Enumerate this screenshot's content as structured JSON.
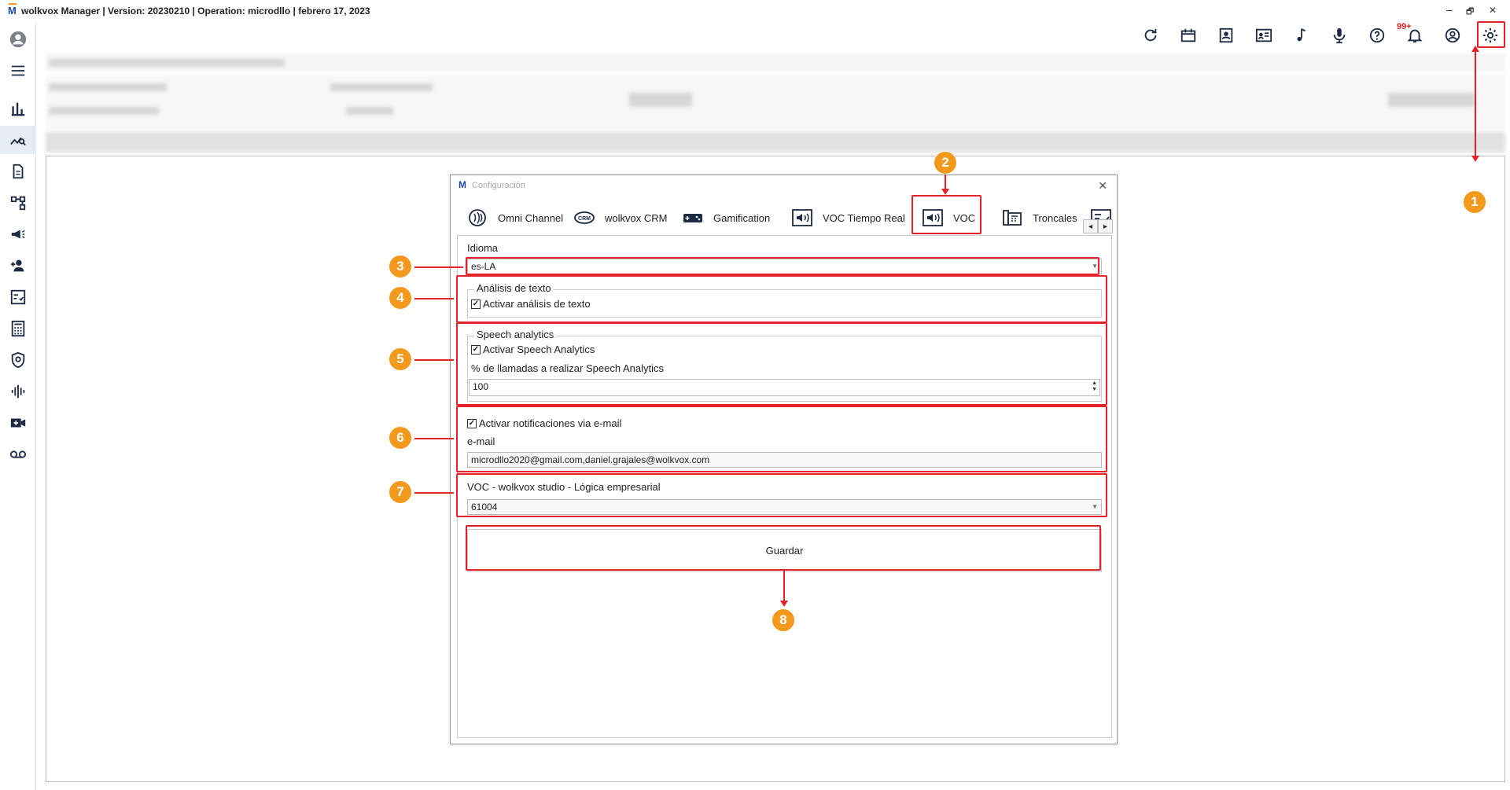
{
  "window": {
    "logo": "M",
    "title": "wolkvox Manager  | Version: 20230210 |  Operation: microdllo | febrero 17, 2023",
    "controls": [
      "–",
      "🗗",
      "✕"
    ]
  },
  "toolbar": {
    "icons": [
      "refresh-icon",
      "ticket-icon",
      "contacts-book-icon",
      "id-card-icon",
      "music-note-icon",
      "microphone-icon",
      "help-icon",
      "bell-icon",
      "user-circle-icon",
      "settings-gear-icon"
    ],
    "notification_badge": "99+"
  },
  "sidebar": {
    "icons": [
      "avatar-icon",
      "menu-icon",
      "bar-chart-icon",
      "analytics-search-icon",
      "document-icon",
      "flow-diagram-icon",
      "megaphone-icon",
      "user-add-icon",
      "checklist-icon",
      "calculator-icon",
      "shield-icon",
      "audio-wave-icon",
      "video-add-icon",
      "voicemail-icon"
    ]
  },
  "dialog": {
    "logo": "M",
    "title": "Configuración",
    "close": "✕",
    "tabs": [
      {
        "label": "Omni Channel",
        "icon": "omni-channel-icon"
      },
      {
        "label": "wolkvox CRM",
        "icon": "crm-icon"
      },
      {
        "label": "Gamification",
        "icon": "gamepad-icon"
      },
      {
        "label": "VOC Tiempo Real",
        "icon": "speaker-realtime-icon"
      },
      {
        "label": "VOC",
        "icon": "speaker-icon"
      },
      {
        "label": "Troncales",
        "icon": "phone-trunk-icon"
      }
    ],
    "tab_scroll": [
      "◂",
      "▸"
    ],
    "idioma": {
      "label": "Idioma",
      "value": "es-LA"
    },
    "text_analysis": {
      "title": "Análisis de texto",
      "checkbox_label": "Activar análisis de texto",
      "checked": true
    },
    "speech": {
      "title": "Speech analytics",
      "checkbox_label": "Activar Speech Analytics",
      "checked": true,
      "percent_label": "% de llamadas a realizar Speech Analytics",
      "percent_value": "100"
    },
    "email": {
      "checkbox_label": "Activar notificaciones via e-mail",
      "checked": true,
      "label": "e-mail",
      "value": "microdllo2020@gmail.com,daniel.grajales@wolkvox.com"
    },
    "studio": {
      "label": "VOC - wolkvox studio - Lógica empresarial",
      "value": "61004"
    },
    "save_label": "Guardar"
  },
  "callouts": [
    "1",
    "2",
    "3",
    "4",
    "5",
    "6",
    "7",
    "8"
  ],
  "colors": {
    "accent_red": "#e5212b",
    "callout_orange": "#f39a1e",
    "brand_blue": "#1b4aa8"
  }
}
